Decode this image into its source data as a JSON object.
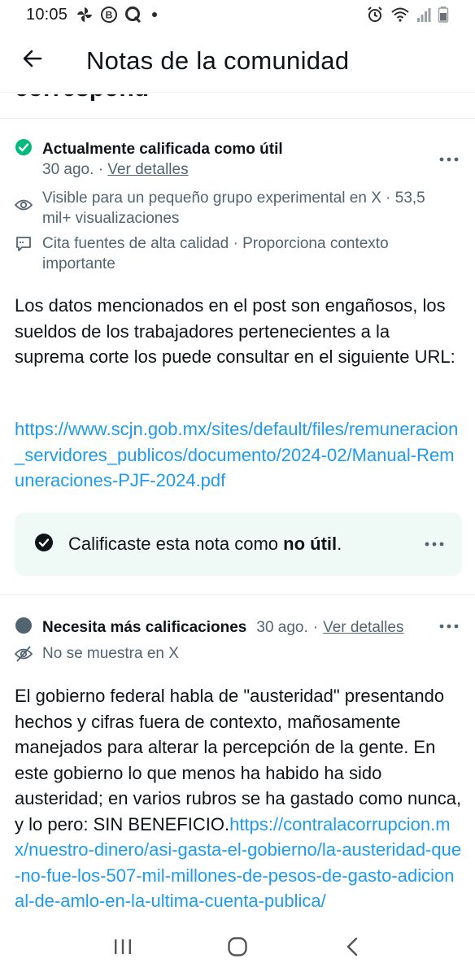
{
  "status_bar": {
    "time": "10:05",
    "left_icons": [
      "pinwheel-icon",
      "b-circle-icon",
      "q-icon",
      "dot-icon"
    ],
    "right_icons": [
      "alarm-icon",
      "wifi-icon",
      "signal-icon",
      "battery-icon"
    ]
  },
  "header": {
    "back_icon": "arrow-left-icon",
    "title": "Notas de la comunidad"
  },
  "cropped_heading": "correspond",
  "note1": {
    "status_icon": "check-circle-icon",
    "status_color": "#00ba7c",
    "status_label": "Actualmente calificada como útil",
    "date": "30 ago.",
    "separator": "·",
    "details_link": "Ver detalles",
    "visibility_icon": "eye-icon",
    "visibility_text": "Visible para un pequeño grupo experimental en X · 53,5 mil+ visualizaciones",
    "quality_icon": "quote-bubble-icon",
    "quality_text": "Cita fuentes de alta calidad · Proporciona contexto importante",
    "body": "Los datos mencionados en el post son engañosos, los sueldos de los trabajadores pertenecientes a la suprema corte los puede consultar en el siguiente URL:",
    "link": "https://www.scjn.gob.mx/sites/default/files/remuneracion_servidores_publicos/documento/2024-02/Manual-Remuneraciones-PJF-2024.pdf",
    "rating": {
      "prefix": "Calificaste esta nota como",
      "value": "no útil",
      "suffix": ".",
      "box_color": "#effaf6"
    }
  },
  "note2": {
    "status_icon": "gray-circle-icon",
    "status_color": "#536471",
    "status_label": "Necesita más calificaciones",
    "date": "30 ago.",
    "separator": "·",
    "details_link": "Ver detalles",
    "visibility_icon": "eye-off-icon",
    "visibility_text": "No se muestra en X",
    "body": "El gobierno federal habla de \"austeridad\" presentando hechos y cifras fuera de contexto, mañosamente manejados para alterar la percepción de la gente. En este gobierno lo que menos ha habido ha sido austeridad; en varios rubros se ha gastado como nunca, y lo pero: SIN BENEFICIO.",
    "link": "https://contralacorrupcion.mx/nuestro-dinero/asi-gasta-el-gobierno/la-austeridad-que-no-fue-los-507-mil-millones-de-pesos-de-gasto-adicional-de-amlo-en-la-ultima-cuenta-publica/"
  },
  "nav_bar": {
    "recents_icon": "recents-icon",
    "home_icon": "home-icon",
    "back_icon": "nav-back-icon"
  },
  "colors": {
    "link": "#1d9bf0",
    "secondary_text": "#536471",
    "primary_text": "#0f1419"
  }
}
